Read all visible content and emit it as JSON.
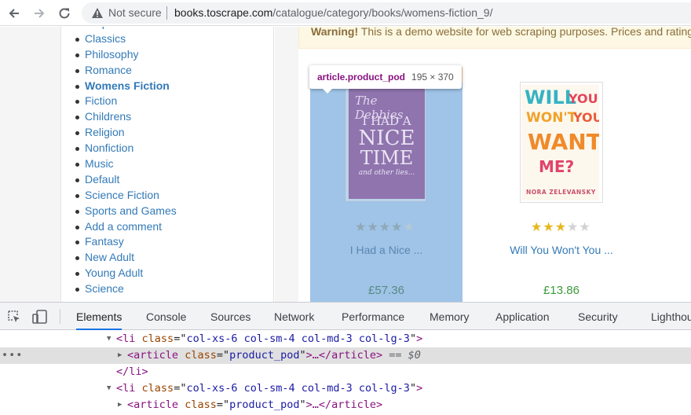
{
  "browser": {
    "security_text": "Not secure",
    "url_host": "books.toscrape.com",
    "url_path": "/catalogue/category/books/womens-fiction_9/"
  },
  "sidebar": {
    "categories": [
      {
        "label": "Sequential Art"
      },
      {
        "label": "Classics"
      },
      {
        "label": "Philosophy"
      },
      {
        "label": "Romance"
      },
      {
        "label": "Womens Fiction",
        "active": true
      },
      {
        "label": "Fiction"
      },
      {
        "label": "Childrens"
      },
      {
        "label": "Religion"
      },
      {
        "label": "Nonfiction"
      },
      {
        "label": "Music"
      },
      {
        "label": "Default"
      },
      {
        "label": "Science Fiction"
      },
      {
        "label": "Sports and Games"
      },
      {
        "label": "Add a comment"
      },
      {
        "label": "Fantasy"
      },
      {
        "label": "New Adult"
      },
      {
        "label": "Young Adult"
      },
      {
        "label": "Science"
      }
    ]
  },
  "banner": {
    "strong": "Warning!",
    "text": " This is a demo website for web scraping purposes. Prices and ratings here were randomly assigned and have no real meaning."
  },
  "inspector_tooltip": {
    "selector": "article.product_pod",
    "size": "195 × 370"
  },
  "products": [
    {
      "title": "I Had a Nice ...",
      "price": "£57.36",
      "rating": 4,
      "cover_text": [
        "The Debbies",
        "I HAD A",
        "NICE",
        "TIME",
        "and other lies..."
      ],
      "highlighted": true,
      "title_color": "#5b86b2",
      "price_color": "#5a8a85"
    },
    {
      "title": "Will You Won't You ...",
      "price": "£13.86",
      "rating": 3,
      "cover_text": [
        "WILL",
        "YOU",
        "WON'T",
        "YOU",
        "WANT",
        "ME?",
        "NORA ZELEVANSKY"
      ],
      "highlighted": false,
      "title_color": "#337ab7",
      "price_color": "#3c9a3c"
    }
  ],
  "devtools": {
    "tabs": [
      "Elements",
      "Console",
      "Sources",
      "Network",
      "Performance",
      "Memory",
      "Application",
      "Security",
      "Lighthouse"
    ],
    "active_tab": "Elements",
    "lines": [
      {
        "indent": 148,
        "expanded": true,
        "tag": "li",
        "attr": "class",
        "value": "col-xs-6 col-sm-4 col-md-3 col-lg-3",
        "tail": ">"
      },
      {
        "indent": 162,
        "expanded": false,
        "tag": "article",
        "attr": "class",
        "value": "product_pod",
        "tail": ">…</article>",
        "selected": true,
        "marker": "== $0"
      },
      {
        "indent": 148,
        "closing": "</li>"
      },
      {
        "indent": 148,
        "expanded": true,
        "tag": "li",
        "attr": "class",
        "value": "col-xs-6 col-sm-4 col-md-3 col-lg-3",
        "tail": ">"
      },
      {
        "indent": 162,
        "expanded": false,
        "tag": "article",
        "attr": "class",
        "value": "product_pod",
        "tail": ">…</article>"
      }
    ]
  }
}
